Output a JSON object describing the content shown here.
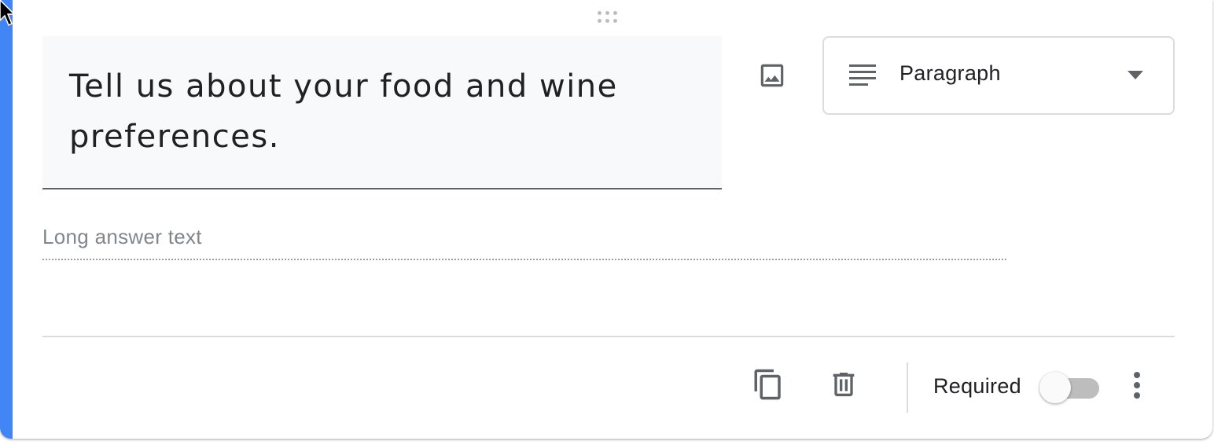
{
  "question": {
    "title": "Tell us about your food and wine preferences.",
    "type_label": "Paragraph",
    "answer_placeholder": "Long answer text"
  },
  "footer": {
    "required_label": "Required",
    "required_on": false
  },
  "icons": {
    "drag": "drag-handle-icon",
    "image": "image-icon",
    "type": "paragraph-lines-icon",
    "dropdown": "chevron-down-icon",
    "duplicate": "copy-icon",
    "delete": "trash-icon",
    "more": "more-vert-icon"
  },
  "colors": {
    "accent": "#4285f4",
    "icon": "#5f6368",
    "title_bg": "#f8f9fa"
  }
}
